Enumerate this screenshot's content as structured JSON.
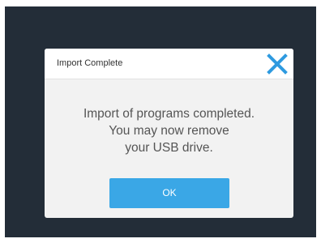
{
  "dialog": {
    "title": "Import Complete",
    "close_icon": "close-icon",
    "message_lines": [
      "Import of programs completed.",
      "You may now remove",
      "your USB drive."
    ],
    "ok_label": "OK"
  },
  "colors": {
    "screen_background": "#232d38",
    "dialog_background": "#f2f2f2",
    "header_background": "#ffffff",
    "accent": "#3aa7e6",
    "message_text": "#555555"
  }
}
